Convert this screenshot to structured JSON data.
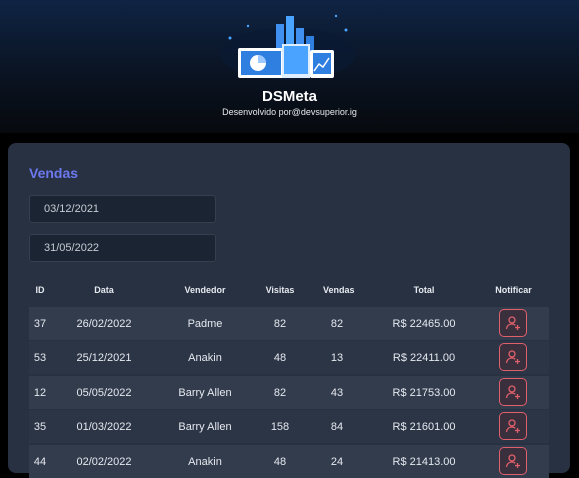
{
  "app": {
    "title": "DSMeta",
    "subtitle": "Desenvolvido por@devsuperior.ig"
  },
  "sales": {
    "title": "Vendas",
    "min_date": "03/12/2021",
    "max_date": "31/05/2022",
    "columns": [
      "ID",
      "Data",
      "Vendedor",
      "Visitas",
      "Vendas",
      "Total",
      "Notificar"
    ],
    "rows": [
      {
        "id": "37",
        "date": "26/02/2022",
        "seller": "Padme",
        "visits": "82",
        "sales": "82",
        "total": "R$ 22465.00"
      },
      {
        "id": "53",
        "date": "25/12/2021",
        "seller": "Anakin",
        "visits": "48",
        "sales": "13",
        "total": "R$ 22411.00"
      },
      {
        "id": "12",
        "date": "05/05/2022",
        "seller": "Barry Allen",
        "visits": "82",
        "sales": "43",
        "total": "R$ 21753.00"
      },
      {
        "id": "35",
        "date": "01/03/2022",
        "seller": "Barry Allen",
        "visits": "158",
        "sales": "84",
        "total": "R$ 21601.00"
      },
      {
        "id": "44",
        "date": "02/02/2022",
        "seller": "Anakin",
        "visits": "48",
        "sales": "24",
        "total": "R$ 21413.00"
      }
    ]
  },
  "colors": {
    "accent": "#6d79f0",
    "card": "#283142",
    "notify": "#e0606c"
  },
  "icons": {
    "logo": "dashboard-logo-icon",
    "notify": "notify-user-icon"
  }
}
